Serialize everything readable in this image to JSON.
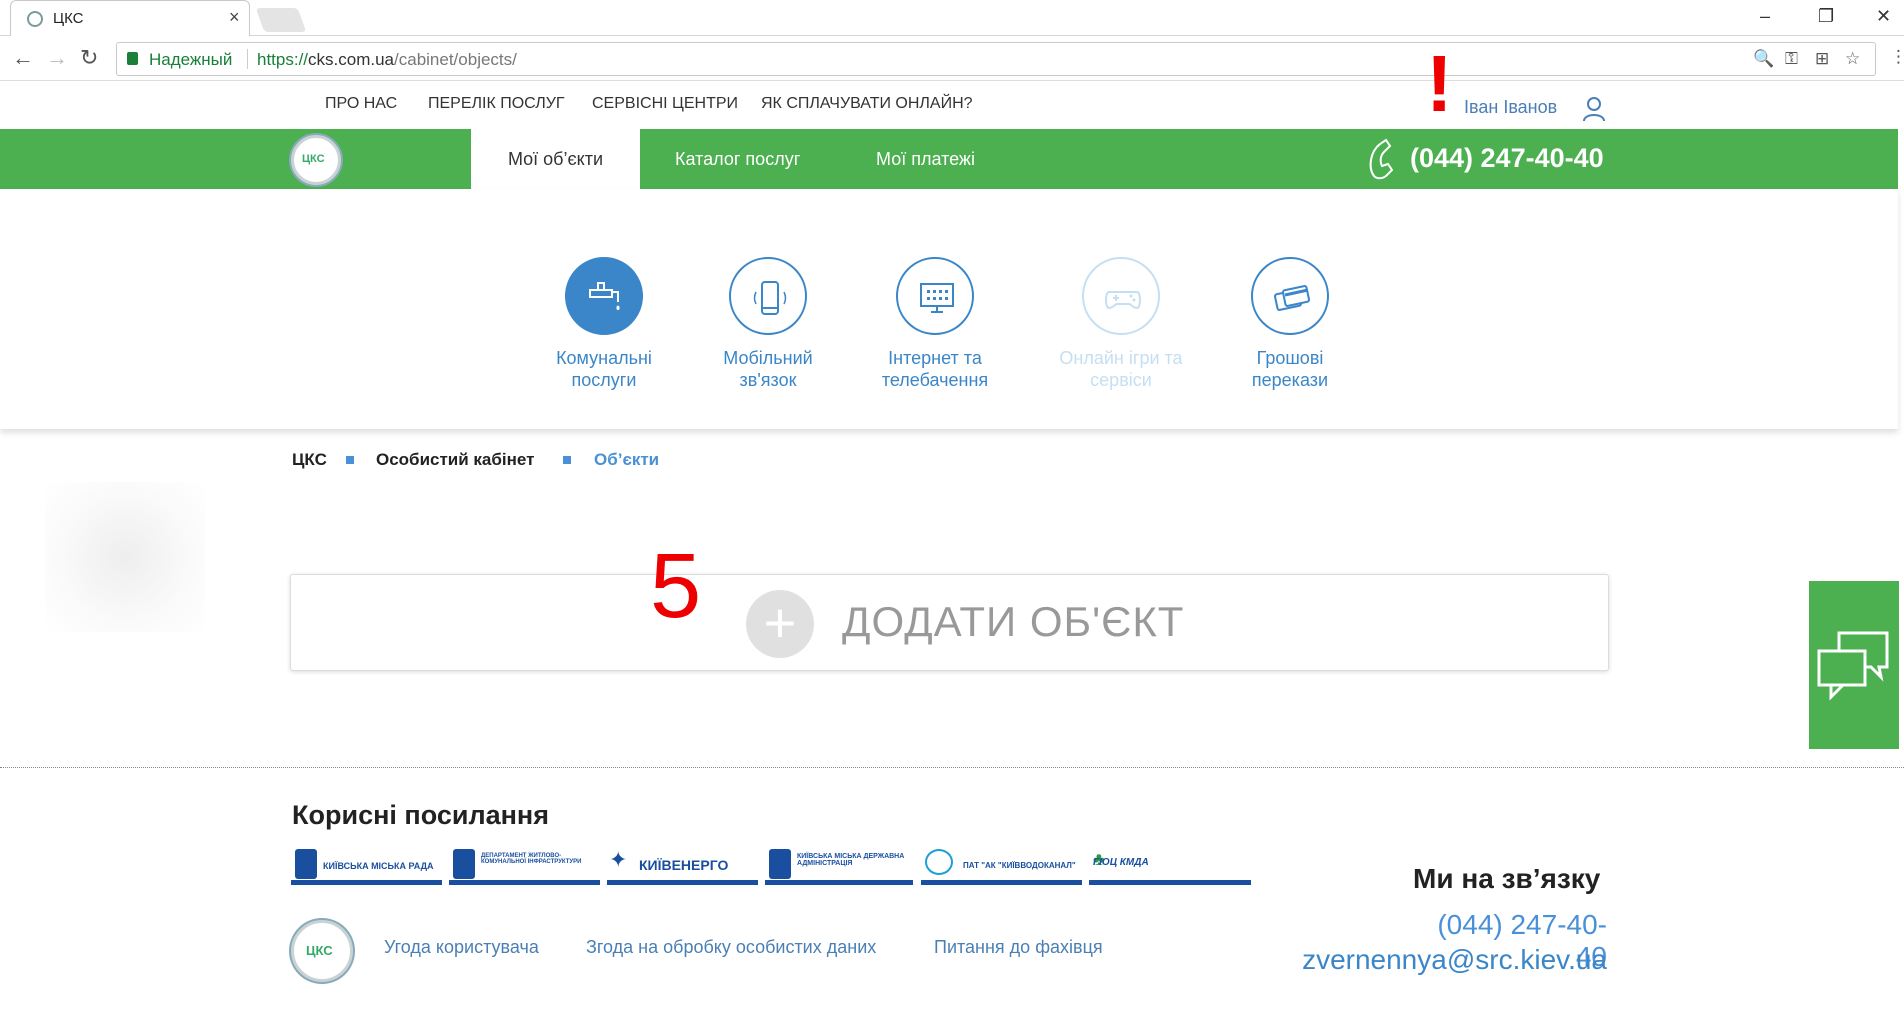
{
  "browser": {
    "tab_title": "ЦКС",
    "tab_close": "×",
    "secure_label": "Надежный",
    "url_proto": "https://",
    "url_host": "cks.com.ua",
    "url_path": "/cabinet/objects/",
    "win_minimize": "–",
    "win_restore": "❐",
    "win_close": "✕",
    "nav_back": "←",
    "nav_forward": "→",
    "nav_reload": "↻",
    "omni_icons": {
      "zoom": "🔍",
      "key": "⚿",
      "translate": "⊞",
      "star": "☆",
      "menu": "⋮"
    }
  },
  "topmenu": {
    "items": [
      "ПРО НАС",
      "ПЕРЕЛІК ПОСЛУГ",
      "СЕРВІСНІ ЦЕНТРИ",
      "ЯК СПЛАЧУВАТИ ОНЛАЙН?"
    ],
    "user_name": "Іван Іванов"
  },
  "annotation": {
    "exclaim": "!",
    "number": "5"
  },
  "header": {
    "logo_text": "ЦКС",
    "tabs": [
      "Мої об’єкти",
      "Каталог послуг",
      "Мої платежі"
    ],
    "phone": "(044) 247-40-40"
  },
  "categories": [
    {
      "label1": "Комунальні",
      "label2": "послуги",
      "icon": "faucet-icon",
      "state": "active"
    },
    {
      "label1": "Мобільний",
      "label2": "зв'язок",
      "icon": "smartphone-icon",
      "state": "normal"
    },
    {
      "label1": "Інтернет та",
      "label2": "телебачення",
      "icon": "monitor-icon",
      "state": "normal"
    },
    {
      "label1": "Онлайн ігри та",
      "label2": "сервіси",
      "icon": "gamepad-icon",
      "state": "disabled"
    },
    {
      "label1": "Грошові",
      "label2": "перекази",
      "icon": "cards-icon",
      "state": "normal"
    }
  ],
  "breadcrumb": [
    "ЦКС",
    "Особистий кабінет",
    "Об’єкти"
  ],
  "add_object": {
    "plus": "+",
    "label": "ДОДАТИ ОБ'ЄКТ"
  },
  "footer": {
    "useful_title": "Корисні посилання",
    "partners": [
      "КИЇВСЬКА МІСЬКА РАДА",
      "ДЕПАРТАМЕНТ ЖИТЛОВО-КОМУНАЛЬНОЇ ІНФРАСТРУКТУРИ",
      "КИЇВЕНЕРГО",
      "КИЇВСЬКА МІСЬКА ДЕРЖАВНА АДМІНІСТРАЦІЯ",
      "ПАТ \"АК \"КИЇВВОДОКАНАЛ\"",
      "ГІОЦ КМДА"
    ],
    "logo_text": "ЦКС",
    "links": [
      "Угода користувача",
      "Згода на обробку особистих даних",
      "Питання до фахівця"
    ],
    "contact_title": "Ми на зв’язку",
    "contact_phone": "(044) 247-40-40",
    "contact_email": "zvernennya@src.kiev.ua"
  },
  "colors": {
    "green": "#4caf50",
    "blue": "#3a86c8",
    "red": "#ee0000"
  }
}
